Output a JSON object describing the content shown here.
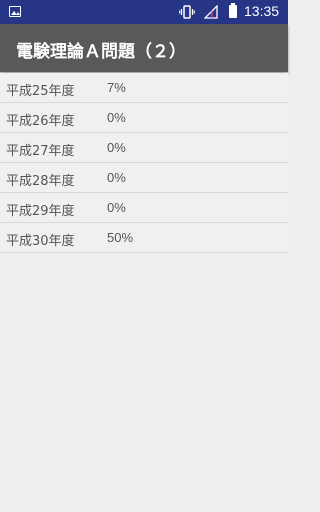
{
  "status_bar": {
    "time": "13:35",
    "icons": [
      "image-notification-icon",
      "vibrate-icon",
      "signal-icon",
      "battery-icon"
    ]
  },
  "app_bar": {
    "title": "電験理論Ａ問題（２）",
    "color": "#595959"
  },
  "rows": [
    {
      "year": "平成25年度",
      "value": "7%"
    },
    {
      "year": "平成26年度",
      "value": "0%"
    },
    {
      "year": "平成27年度",
      "value": "0%"
    },
    {
      "year": "平成28年度",
      "value": "0%"
    },
    {
      "year": "平成29年度",
      "value": "0%"
    },
    {
      "year": "平成30年度",
      "value": "50%"
    }
  ]
}
